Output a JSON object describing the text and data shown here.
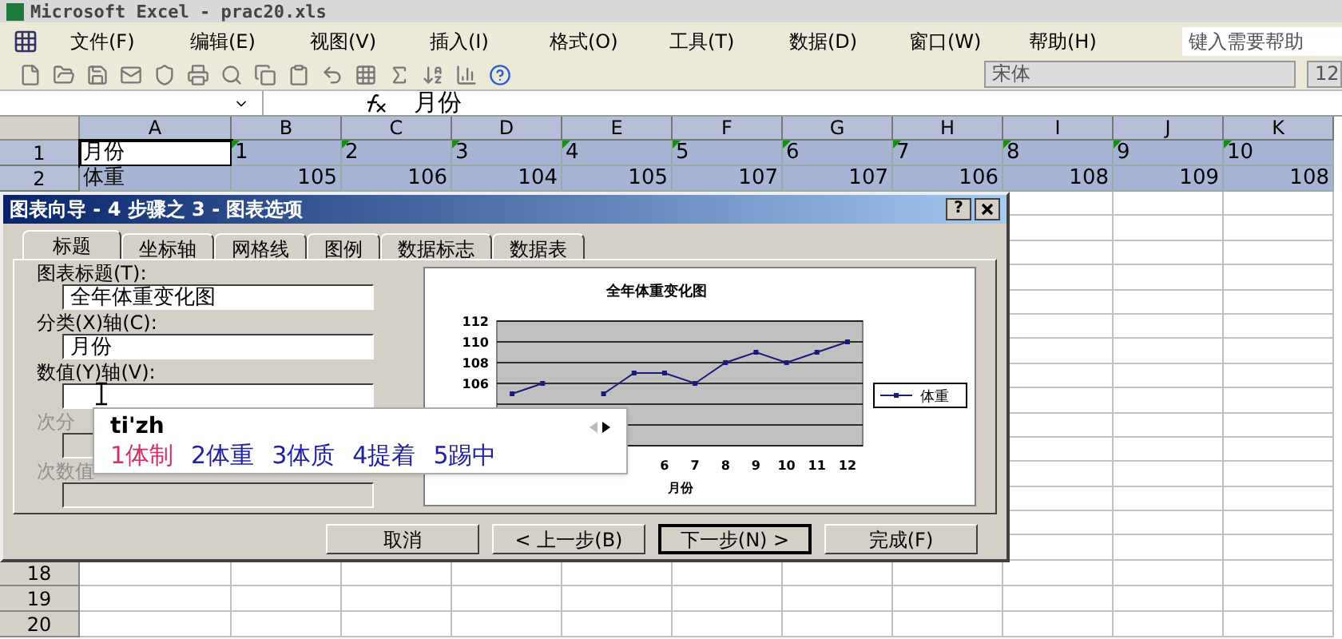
{
  "window": {
    "title": "Microsoft Excel - prac20.xls"
  },
  "menu": [
    "文件(F)",
    "编辑(E)",
    "视图(V)",
    "插入(I)",
    "格式(O)",
    "工具(T)",
    "数据(D)",
    "窗口(W)",
    "帮助(H)"
  ],
  "help_box": {
    "placeholder": "键入需要帮助"
  },
  "toolbar": {
    "font": "宋体",
    "size": "12"
  },
  "formula_bar": {
    "formula": "月份"
  },
  "sheet": {
    "columns": [
      "A",
      "B",
      "C",
      "D",
      "E",
      "F",
      "G",
      "H",
      "I",
      "J",
      "K"
    ],
    "rows": [
      {
        "header": "1",
        "cells": [
          {
            "value": "月份",
            "kind": "text",
            "active": true
          },
          {
            "value": "1",
            "kind": "text_number",
            "active": false
          },
          {
            "value": "2",
            "kind": "text_number",
            "active": false
          },
          {
            "value": "3",
            "kind": "text_number",
            "active": false
          },
          {
            "value": "4",
            "kind": "text_number",
            "active": false
          },
          {
            "value": "5",
            "kind": "text_number",
            "active": false
          },
          {
            "value": "6",
            "kind": "text_number",
            "active": false
          },
          {
            "value": "7",
            "kind": "text_number",
            "active": false
          },
          {
            "value": "8",
            "kind": "text_number",
            "active": false
          },
          {
            "value": "9",
            "kind": "text_number",
            "active": false
          },
          {
            "value": "10",
            "kind": "text_number",
            "active": false
          }
        ]
      },
      {
        "header": "2",
        "cells": [
          {
            "value": "体重",
            "kind": "text",
            "active": false
          },
          {
            "value": "105",
            "kind": "number",
            "active": false
          },
          {
            "value": "106",
            "kind": "number",
            "active": false
          },
          {
            "value": "104",
            "kind": "number",
            "active": false
          },
          {
            "value": "105",
            "kind": "number",
            "active": false
          },
          {
            "value": "107",
            "kind": "number",
            "active": false
          },
          {
            "value": "107",
            "kind": "number",
            "active": false
          },
          {
            "value": "106",
            "kind": "number",
            "active": false
          },
          {
            "value": "108",
            "kind": "number",
            "active": false
          },
          {
            "value": "109",
            "kind": "number",
            "active": false
          },
          {
            "value": "108",
            "kind": "number",
            "active": false
          }
        ]
      }
    ],
    "bottom_rows": [
      "18",
      "19",
      "20"
    ]
  },
  "dialog": {
    "title": "图表向导 - 4 步骤之 3 - 图表选项",
    "help_button": "?",
    "tabs": [
      {
        "label": "标题",
        "selected": true
      },
      {
        "label": "坐标轴",
        "selected": false
      },
      {
        "label": "网格线",
        "selected": false
      },
      {
        "label": "图例",
        "selected": false
      },
      {
        "label": "数据标志",
        "selected": false
      },
      {
        "label": "数据表",
        "selected": false
      }
    ],
    "fields": [
      {
        "label": "图表标题(T):",
        "value": "全年体重变化图",
        "disabled": false
      },
      {
        "label": "分类(X)轴(C):",
        "value": "月份",
        "disabled": false
      },
      {
        "label": "数值(Y)轴(V):",
        "disabled": false
      },
      {
        "label": "次分",
        "disabled": true
      },
      {
        "label": "次数值",
        "disabled": true
      }
    ],
    "chart_data": {
      "type": "line",
      "title": "全年体重变化图",
      "xlabel": "月份",
      "categories": [
        null,
        null,
        null,
        null,
        null,
        "6",
        "7",
        "8",
        "9",
        "10",
        "11",
        "12"
      ],
      "series": [
        {
          "name": "体重",
          "color": "#1a1a7a",
          "marker": true,
          "values": [
            105,
            106,
            null,
            105,
            107,
            107,
            106,
            108,
            109,
            108,
            109,
            110
          ]
        }
      ],
      "ylim": [
        100,
        112
      ],
      "yticks": [
        106,
        108,
        110,
        112
      ],
      "grid": true
    },
    "buttons": [
      {
        "label": "取消",
        "default": false
      },
      {
        "label": "< 上一步(B)",
        "default": false
      },
      {
        "label": "下一步(N) >",
        "default": true
      },
      {
        "label": "完成(F)",
        "default": false
      }
    ]
  },
  "ime": {
    "input": "ti'zh",
    "candidates": [
      {
        "label": "1体制",
        "selected": true
      },
      {
        "label": "2体重",
        "selected": false
      },
      {
        "label": "3体质",
        "selected": false
      },
      {
        "label": "4提着",
        "selected": false
      },
      {
        "label": "5踢中",
        "selected": false
      }
    ]
  }
}
